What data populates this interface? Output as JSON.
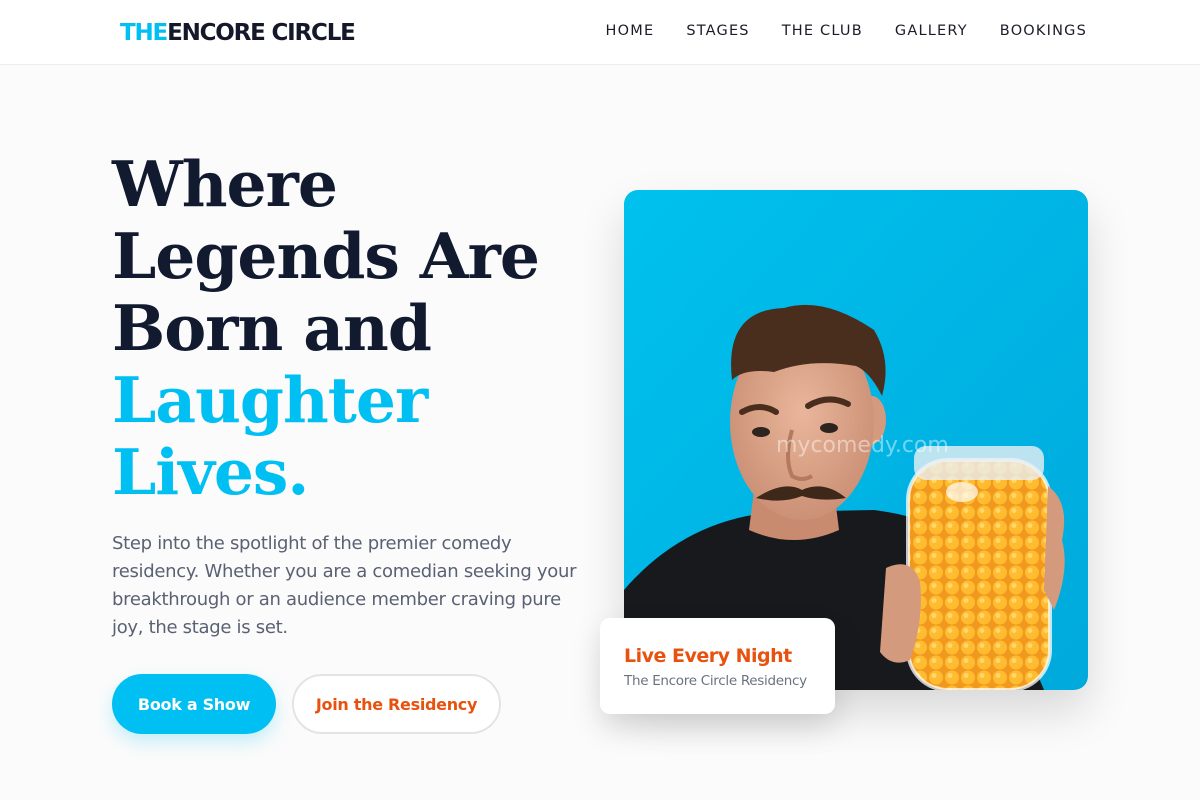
{
  "brand": {
    "logo_accent": "THE",
    "logo_main": "ENCORE CIRCLE"
  },
  "nav": {
    "items": [
      {
        "label": "HOME"
      },
      {
        "label": "STAGES"
      },
      {
        "label": "THE CLUB"
      },
      {
        "label": "GALLERY"
      },
      {
        "label": "BOOKINGS"
      }
    ]
  },
  "hero": {
    "headline_line1": "Where",
    "headline_line2": "Legends Are Born and",
    "headline_line3": "Laughter Lives.",
    "subtext": "Step into the spotlight of the premier comedy residency. Whether you are a comedian seeking your breakthrough or an audience member craving pure joy, the stage is set.",
    "primary_button": "Book a Show",
    "secondary_button": "Join the Residency",
    "image_watermark": "mycomedy.com"
  },
  "badge": {
    "title": "Live Every Night",
    "subtitle": "The Encore Circle Residency"
  },
  "colors": {
    "accent": "#00bff3",
    "secondary": "#e8520f",
    "heading": "#111a2e",
    "photo_background": "#00b9e8"
  }
}
